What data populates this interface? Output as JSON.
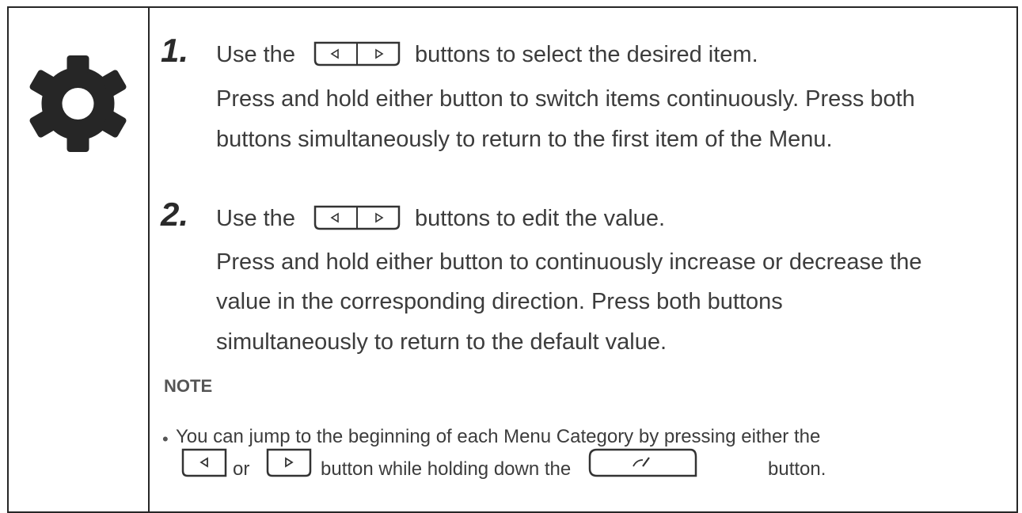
{
  "step1": {
    "number": "1.",
    "lead": "Use the",
    "after": "buttons to select the desired item.",
    "line2": "Press and hold either button to switch items continuously. Press both",
    "line3": "buttons simultaneously to return to the first item of the Menu."
  },
  "step2": {
    "number": "2.",
    "lead": "Use the",
    "after": "buttons to edit the value.",
    "line2": "Press and hold either button to continuously increase or decrease the",
    "line3": "value in the corresponding direction. Press both buttons",
    "line4": "simultaneously to return to the default value."
  },
  "note": {
    "title": "NOTE",
    "bullet": "•",
    "line1": "You can jump to the beginning of each Menu Category by pressing either the",
    "or": "or",
    "middle": "button while holding down the",
    "end": "button."
  },
  "icons": {
    "gear": "gear-icon",
    "left_button": "left-arrow-button-icon",
    "right_button": "right-arrow-button-icon",
    "edit_button": "edit-button-icon"
  }
}
